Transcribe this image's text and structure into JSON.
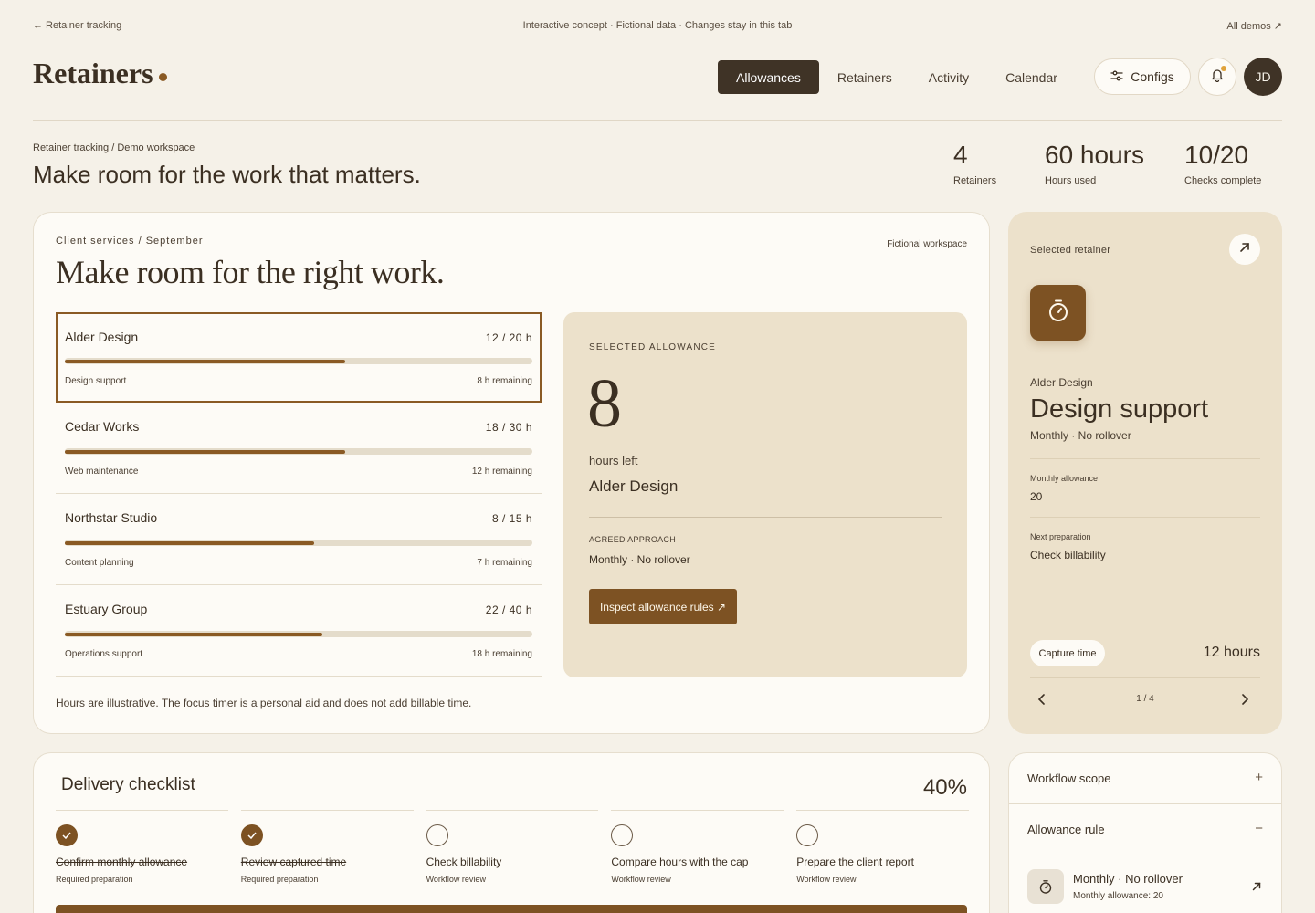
{
  "topbar": {
    "back_link": "← Retainer tracking",
    "notice": "Interactive concept · Fictional data · Changes stay in this tab",
    "all_demos": "All demos ↗"
  },
  "header": {
    "brand": "Retainers",
    "tabs": [
      {
        "label": "Allowances",
        "active": true
      },
      {
        "label": "Retainers",
        "active": false
      },
      {
        "label": "Activity",
        "active": false
      },
      {
        "label": "Calendar",
        "active": false
      }
    ],
    "configs_label": "Configs",
    "avatar_initials": "JD",
    "accent_color": "#8a5a24",
    "notification_dot_color": "#e0a23a"
  },
  "intro": {
    "breadcrumb": "Retainer tracking / Demo workspace",
    "headline": "Make room for the work that matters.",
    "stats": [
      {
        "value": "4",
        "label": "Retainers"
      },
      {
        "value": "60 hours",
        "label": "Hours used"
      },
      {
        "value": "10/20",
        "label": "Checks complete"
      }
    ]
  },
  "main": {
    "eyebrow": "Client services / September",
    "badge": "Fictional workspace",
    "title": "Make room for the right work.",
    "retainers": [
      {
        "name": "Alder Design",
        "hours": "12 / 20 h",
        "progress": 0.6,
        "kind": "Design support",
        "remaining": "8 h remaining",
        "selected": true
      },
      {
        "name": "Cedar Works",
        "hours": "18 / 30 h",
        "progress": 0.6,
        "kind": "Web maintenance",
        "remaining": "12 h remaining",
        "selected": false
      },
      {
        "name": "Northstar Studio",
        "hours": "8 / 15 h",
        "progress": 0.533,
        "kind": "Content planning",
        "remaining": "7 h remaining",
        "selected": false
      },
      {
        "name": "Estuary Group",
        "hours": "22 / 40 h",
        "progress": 0.55,
        "kind": "Operations support",
        "remaining": "18 h remaining",
        "selected": false
      }
    ],
    "footnote": "Hours are illustrative. The focus timer is a personal aid and does not add billable time.",
    "selected": {
      "eyebrow": "SELECTED ALLOWANCE",
      "hours_left_value": "8",
      "hours_left_label": "hours left",
      "client": "Alder Design",
      "approach_label": "AGREED APPROACH",
      "approach": "Monthly · No rollover",
      "button": "Inspect allowance rules ↗"
    }
  },
  "side": {
    "eyebrow": "Selected retainer",
    "icon": "stopwatch-icon",
    "client": "Alder Design",
    "title": "Design support",
    "subtitle": "Monthly · No rollover",
    "monthly_allowance_label": "Monthly allowance",
    "monthly_allowance": "20",
    "next_prep_label": "Next preparation",
    "next_prep": "Check billability",
    "capture_label": "Capture time",
    "capture_value": "12 hours",
    "pager": "1 / 4"
  },
  "checklist": {
    "title": "Delivery checklist",
    "percent": "40%",
    "items": [
      {
        "label": "Confirm monthly allowance",
        "sub": "Required preparation",
        "done": true
      },
      {
        "label": "Review captured time",
        "sub": "Required preparation",
        "done": true
      },
      {
        "label": "Check billability",
        "sub": "Workflow review",
        "done": false
      },
      {
        "label": "Compare hours with the cap",
        "sub": "Workflow review",
        "done": false
      },
      {
        "label": "Prepare the client report",
        "sub": "Workflow review",
        "done": false
      }
    ]
  },
  "accordion": {
    "rows": [
      {
        "label": "Workflow scope",
        "symbol": "+"
      },
      {
        "label": "Allowance rule",
        "symbol": "−"
      }
    ],
    "detail_title": "Monthly · No rollover",
    "detail_sub": "Monthly allowance: 20"
  }
}
